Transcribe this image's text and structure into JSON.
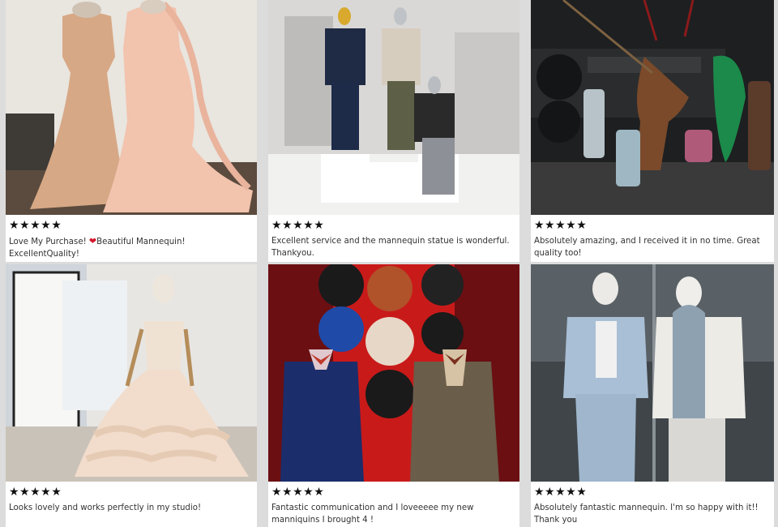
{
  "reviews": [
    {
      "stars": "★★★★★",
      "text_a": "Love My Purchase! ",
      "heart": "❤",
      "text_b": "Beautiful Mannequin! ExcellentQuality!"
    },
    {
      "stars": "★★★★★",
      "text": "Excellent service and the mannequin statue is wonderful. Thankyou."
    },
    {
      "stars": "★★★★★",
      "text": "Absolutely amazing, and I received it in no time. Great quality too!"
    },
    {
      "stars": "★★★★★",
      "text": "Looks lovely and works perfectly in my studio!"
    },
    {
      "stars": "★★★★★",
      "text": "Fantastic communication and I loveeeee my new manniquins I brought 4 !"
    },
    {
      "stars": "★★★★★",
      "text": "Absolutely fantastic mannequin. I'm so happy with it!! Thank you"
    }
  ]
}
